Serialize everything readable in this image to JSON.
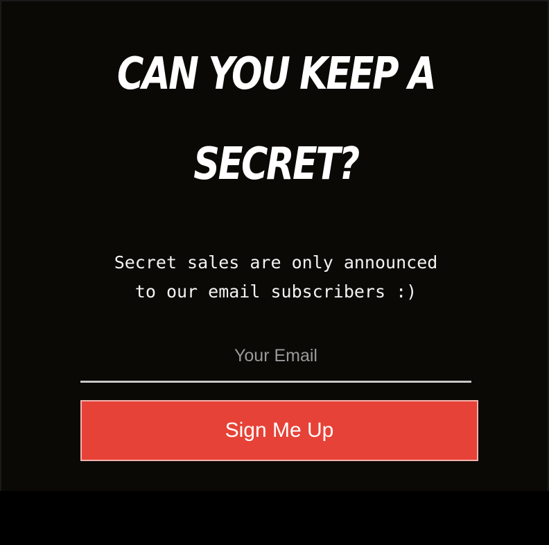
{
  "popup": {
    "headline_line1": "CAN YOU KEEP A",
    "headline_line2": "SECRET?",
    "subtext_line1": "Secret sales are only announced",
    "subtext_line2": "to our email subscribers :)",
    "email_field": {
      "value": "",
      "placeholder": "Your Email"
    },
    "submit_label": "Sign Me Up"
  },
  "colors": {
    "background": "#0b0906",
    "button": "#e64237",
    "text": "#ffffff",
    "placeholder": "#9a9a9a"
  }
}
